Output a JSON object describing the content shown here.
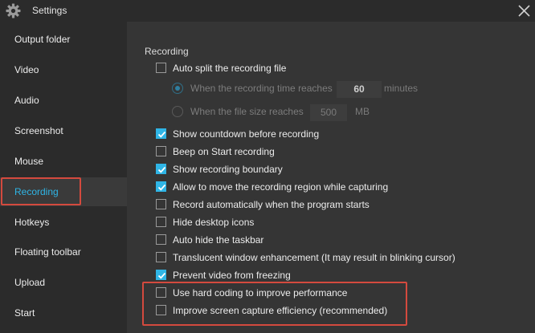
{
  "window": {
    "title": "Settings",
    "icon": "gear-icon",
    "close_icon": "close-icon"
  },
  "sidebar": {
    "items": [
      {
        "label": "Output folder"
      },
      {
        "label": "Video"
      },
      {
        "label": "Audio"
      },
      {
        "label": "Screenshot"
      },
      {
        "label": "Mouse"
      },
      {
        "label": "Recording",
        "active": true
      },
      {
        "label": "Hotkeys"
      },
      {
        "label": "Floating toolbar"
      },
      {
        "label": "Upload"
      },
      {
        "label": "Start"
      }
    ]
  },
  "recording": {
    "section_title": "Recording",
    "auto_split": {
      "label": "Auto split the recording file",
      "checked": false
    },
    "split_by_time": {
      "label": "When the recording time reaches",
      "value": "60",
      "unit": "minutes",
      "selected": true
    },
    "split_by_size": {
      "label": "When the file size reaches",
      "value": "500",
      "unit": "MB",
      "selected": false
    },
    "options": [
      {
        "label": "Show countdown before recording",
        "checked": true
      },
      {
        "label": "Beep on Start recording",
        "checked": false
      },
      {
        "label": "Show recording boundary",
        "checked": true
      },
      {
        "label": "Allow to move the recording region while capturing",
        "checked": true
      },
      {
        "label": "Record automatically when the program starts",
        "checked": false
      },
      {
        "label": "Hide desktop icons",
        "checked": false
      },
      {
        "label": "Auto hide the taskbar",
        "checked": false
      },
      {
        "label": "Translucent window enhancement (It may result in blinking cursor)",
        "checked": false
      },
      {
        "label": "Prevent video from freezing",
        "checked": true
      },
      {
        "label": "Use hard coding to improve performance",
        "checked": false
      },
      {
        "label": "Improve screen capture efficiency (recommended)",
        "checked": false
      }
    ]
  },
  "colors": {
    "accent": "#2fb5e6",
    "highlight": "#d44a3e",
    "sidebar_bg": "#2b2b2b",
    "content_bg": "#353535"
  }
}
